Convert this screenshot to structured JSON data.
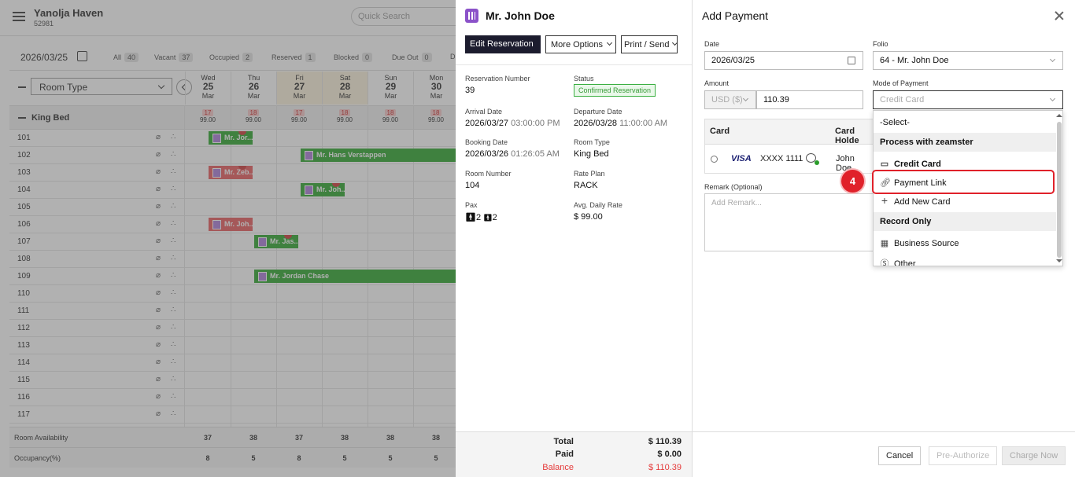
{
  "topbar": {
    "hotel_name": "Yanolja Haven",
    "hotel_id": "52981",
    "search_placeholder": "Quick Search"
  },
  "filterbar": {
    "date": "2026/03/25",
    "filters": [
      {
        "label": "All",
        "count": "40"
      },
      {
        "label": "Vacant",
        "count": "37"
      },
      {
        "label": "Occupied",
        "count": "2"
      },
      {
        "label": "Reserved",
        "count": "1"
      },
      {
        "label": "Blocked",
        "count": "0"
      },
      {
        "label": "Due Out",
        "count": "0"
      },
      {
        "label": "D",
        "count": ""
      }
    ]
  },
  "calendar": {
    "room_type_label": "Room Type",
    "days": [
      {
        "dow": "Wed",
        "day": "25",
        "month": "Mar",
        "weekend": false,
        "avail": "17",
        "rate": "99.00"
      },
      {
        "dow": "Thu",
        "day": "26",
        "month": "Mar",
        "weekend": false,
        "avail": "18",
        "rate": "99.00"
      },
      {
        "dow": "Fri",
        "day": "27",
        "month": "Mar",
        "weekend": true,
        "avail": "17",
        "rate": "99.00"
      },
      {
        "dow": "Sat",
        "day": "28",
        "month": "Mar",
        "weekend": true,
        "avail": "18",
        "rate": "99.00"
      },
      {
        "dow": "Sun",
        "day": "29",
        "month": "Mar",
        "weekend": false,
        "avail": "18",
        "rate": "99.00"
      },
      {
        "dow": "Mon",
        "day": "30",
        "month": "Mar",
        "weekend": false,
        "avail": "18",
        "rate": "99.00"
      }
    ],
    "room_group": "King Bed",
    "rooms": [
      "101",
      "102",
      "103",
      "104",
      "105",
      "106",
      "107",
      "108",
      "109",
      "110",
      "111",
      "112",
      "113",
      "114",
      "115",
      "116",
      "117"
    ],
    "reservations": [
      {
        "name": "Mr. Jor...",
        "color": "g"
      },
      {
        "name": "Mr. Hans Verstappen",
        "color": "g"
      },
      {
        "name": "Mr. Zeb...",
        "color": "r"
      },
      {
        "name": "Mr. Joh...",
        "color": "g"
      },
      {
        "name": "Mr. Joh...",
        "color": "r"
      },
      {
        "name": "Mr. Jas...",
        "color": "g"
      },
      {
        "name": "Mr. Jordan Chase",
        "color": "g"
      }
    ],
    "footer": {
      "availability_label": "Room Availability",
      "availability": [
        "37",
        "38",
        "37",
        "38",
        "38",
        "38"
      ],
      "occupancy_label": "Occupancy(%)",
      "occupancy": [
        "8",
        "5",
        "8",
        "5",
        "5",
        "5"
      ]
    }
  },
  "reservation": {
    "guest_name": "Mr. John Doe",
    "edit_label": "Edit Reservation",
    "more_label": "More Options",
    "print_label": "Print / Send",
    "fields": {
      "res_number_label": "Reservation Number",
      "res_number": "39",
      "status_label": "Status",
      "status": "Confirmed Reservation",
      "arrival_label": "Arrival Date",
      "arrival_date": "2026/03/27",
      "arrival_time": "03:00:00 PM",
      "departure_label": "Departure Date",
      "departure_date": "2026/03/28",
      "departure_time": "11:00:00 AM",
      "booking_label": "Booking Date",
      "booking_date": "2026/03/26",
      "booking_time": "01:26:05 AM",
      "room_type_label": "Room Type",
      "room_type": "King Bed",
      "room_number_label": "Room Number",
      "room_number": "104",
      "rate_plan_label": "Rate Plan",
      "rate_plan": "RACK",
      "pax_label": "Pax",
      "pax_adults": "2",
      "pax_children": "2",
      "adr_label": "Avg. Daily Rate",
      "adr": "$ 99.00"
    },
    "totals": {
      "total_label": "Total",
      "total": "$ 110.39",
      "paid_label": "Paid",
      "paid": "$ 0.00",
      "balance_label": "Balance",
      "balance": "$ 110.39"
    }
  },
  "payment": {
    "title": "Add Payment",
    "date_label": "Date",
    "date": "2026/03/25",
    "folio_label": "Folio",
    "folio": "64 - Mr. John Doe",
    "amount_label": "Amount",
    "currency": "USD ($)",
    "amount": "110.39",
    "mode_label": "Mode of Payment",
    "mode": "Credit Card",
    "card_col": "Card",
    "holder_col": "Card Holde",
    "card_brand": "VISA",
    "card_number": "XXXX 1111",
    "card_holder": "John Doe",
    "remark_label": "Remark (Optional)",
    "remark_placeholder": "Add Remark...",
    "cancel_label": "Cancel",
    "preauth_label": "Pre-Authorize",
    "charge_label": "Charge Now"
  },
  "dropdown": {
    "select": "-Select-",
    "group1": "Process with zeamster",
    "credit_card": "Credit Card",
    "payment_link": "Payment Link",
    "add_card": "Add New Card",
    "group2": "Record Only",
    "business_source": "Business Source",
    "other": "Other"
  },
  "step_number": "4"
}
